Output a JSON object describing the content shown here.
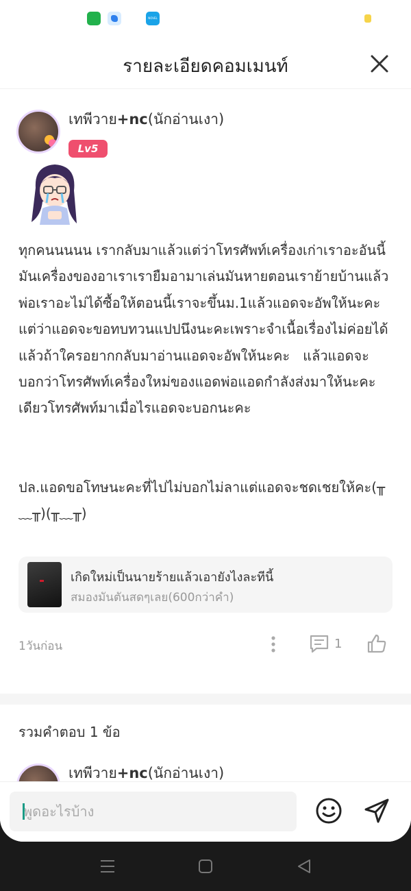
{
  "status_bar": {
    "app_icons": [
      "shopping-bag-icon",
      "chat-bubble-icon",
      "noveltoon-app-icon"
    ],
    "noveltoon_icon_text": "NOVEL TOON"
  },
  "header": {
    "title": "รายละเอียดคอมเมนท์",
    "close_icon": "close-icon"
  },
  "comment": {
    "username_prefix": "เทพีวาย",
    "username_bold": "+nc",
    "username_suffix": "(นักอ่านเงา)",
    "level": "Lv5",
    "body": "ทุกคนนนนน เรากลับมาแล้วแต่ว่าโทรศัพท์เครื่องเก่าเราอะอันนี้มันเครื่องของอาเราเรายืมอามาเล่นมันหายตอนเราย้ายบ้านแล้วพ่อเราอะไม่ได้ซื้อให้ตอนนี้เราจะขึ้นม.1แล้วแอดจะอัพให้นะคะแต่ว่าแอดจะขอทบทวนแปปนึงนะคะเพราะจำเนื้อเรื่องไม่ค่อยได้แล้วถ้าใครอยากกลับมาอ่านแอดจะอัพให้นะคะ   แล้วแอดจะบอกว่าโทรศัพท์เครื่องใหม่ของแอดพ่อแอดกำลังส่งมาให้นะคะเดียวโทรศัพท์มาเมื่อไรแอดจะบอกนะคะ\n\n\nปล.แอดขอโทษนะคะที่ไปไม่บอกไม่ลาแต่แอดจะชดเชยให้คะ(╥﹏╥)(╥﹏╥)",
    "book": {
      "title": "เกิดใหม่เป็นนายร้ายแล้วเอายังไงละทีนี้",
      "subtitle": "สมองมันตันสดๆเลย(600กว่าคำ)"
    },
    "time": "1วันก่อน",
    "reply_count": "1"
  },
  "replies": {
    "heading": "รวมคำตอบ 1 ข้อ",
    "first_username_prefix": "เทพีวาย",
    "first_username_bold": "+nc",
    "first_username_suffix": "(นักอ่านเงา)"
  },
  "input": {
    "placeholder": "พูดอะไรบ้าง",
    "value": ""
  },
  "colors": {
    "level_badge": "#ef4f6e",
    "caret": "#1a9b86",
    "secondary_text": "#999999"
  }
}
